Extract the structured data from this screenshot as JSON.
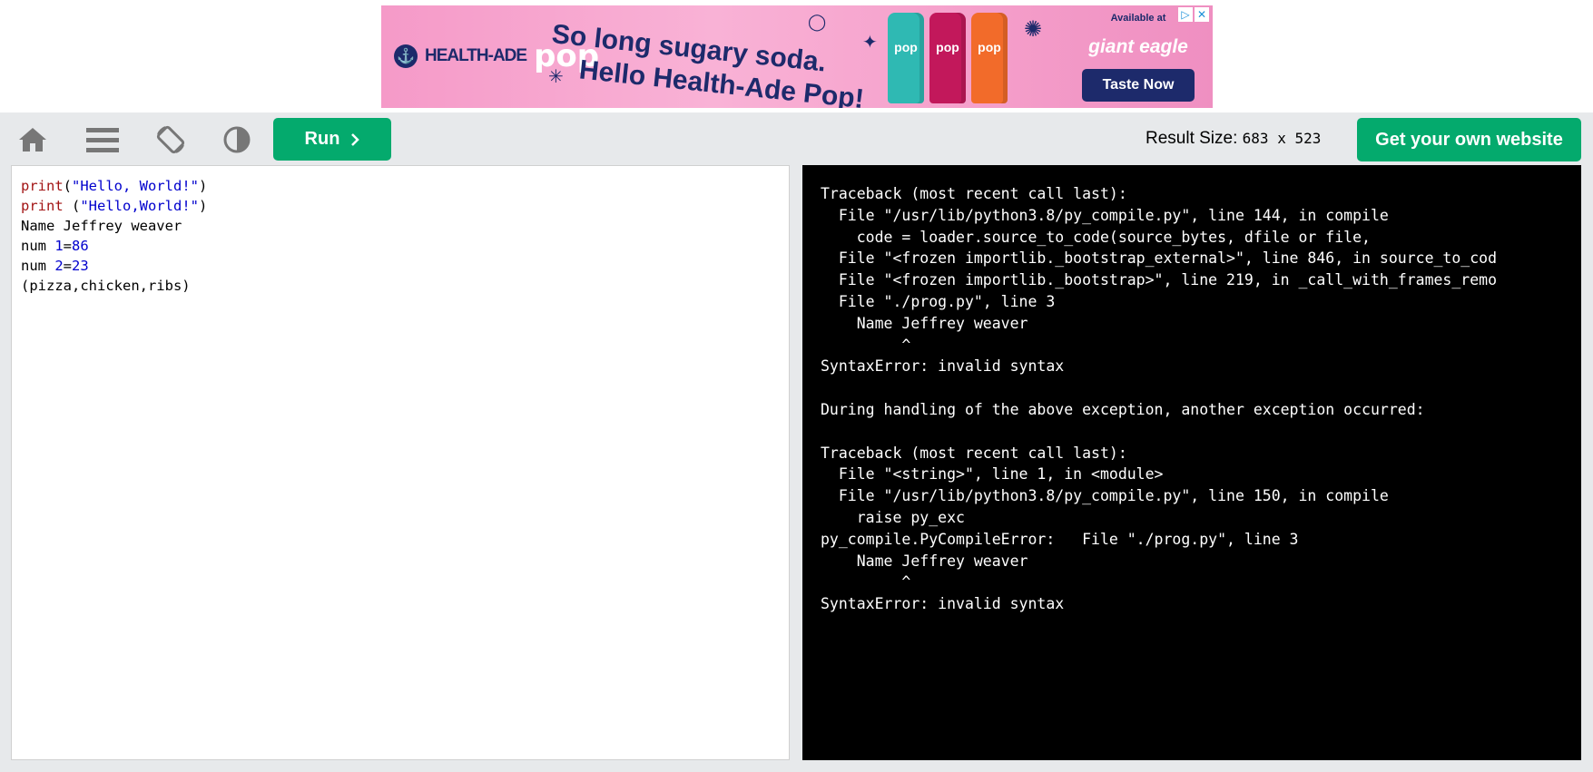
{
  "ad": {
    "brand": "HEALTH-ADE",
    "brand_pop": "pop",
    "headline_line1": "So long sugary soda.",
    "headline_line2": "Hello Health-Ade Pop!",
    "can_label": "pop",
    "available_at": "Available at",
    "store": "giant eagle",
    "cta": "Taste Now",
    "adchoices_icon": "adchoices-icon",
    "close_icon": "close-icon"
  },
  "toolbar": {
    "icons": [
      "home-icon",
      "menu-icon",
      "rotate-icon",
      "contrast-icon"
    ],
    "run_label": "Run",
    "result_size_label": "Result Size:",
    "result_size_value": "683 x 523",
    "own_website_label": "Get your own website"
  },
  "editor": {
    "lines": [
      "print(\"Hello, World!\")",
      "print (\"Hello,World!\")",
      "Name Jeffrey weaver",
      "num 1=86",
      "num 2=23",
      "(pizza,chicken,ribs)"
    ]
  },
  "output": {
    "lines": [
      "Traceback (most recent call last):",
      "  File \"/usr/lib/python3.8/py_compile.py\", line 144, in compile",
      "    code = loader.source_to_code(source_bytes, dfile or file,",
      "  File \"<frozen importlib._bootstrap_external>\", line 846, in source_to_cod",
      "  File \"<frozen importlib._bootstrap>\", line 219, in _call_with_frames_remo",
      "  File \"./prog.py\", line 3",
      "    Name Jeffrey weaver",
      "         ^",
      "SyntaxError: invalid syntax",
      "",
      "During handling of the above exception, another exception occurred:",
      "",
      "Traceback (most recent call last):",
      "  File \"<string>\", line 1, in <module>",
      "  File \"/usr/lib/python3.8/py_compile.py\", line 150, in compile",
      "    raise py_exc",
      "py_compile.PyCompileError:   File \"./prog.py\", line 3",
      "    Name Jeffrey weaver",
      "         ^",
      "SyntaxError: invalid syntax"
    ]
  }
}
